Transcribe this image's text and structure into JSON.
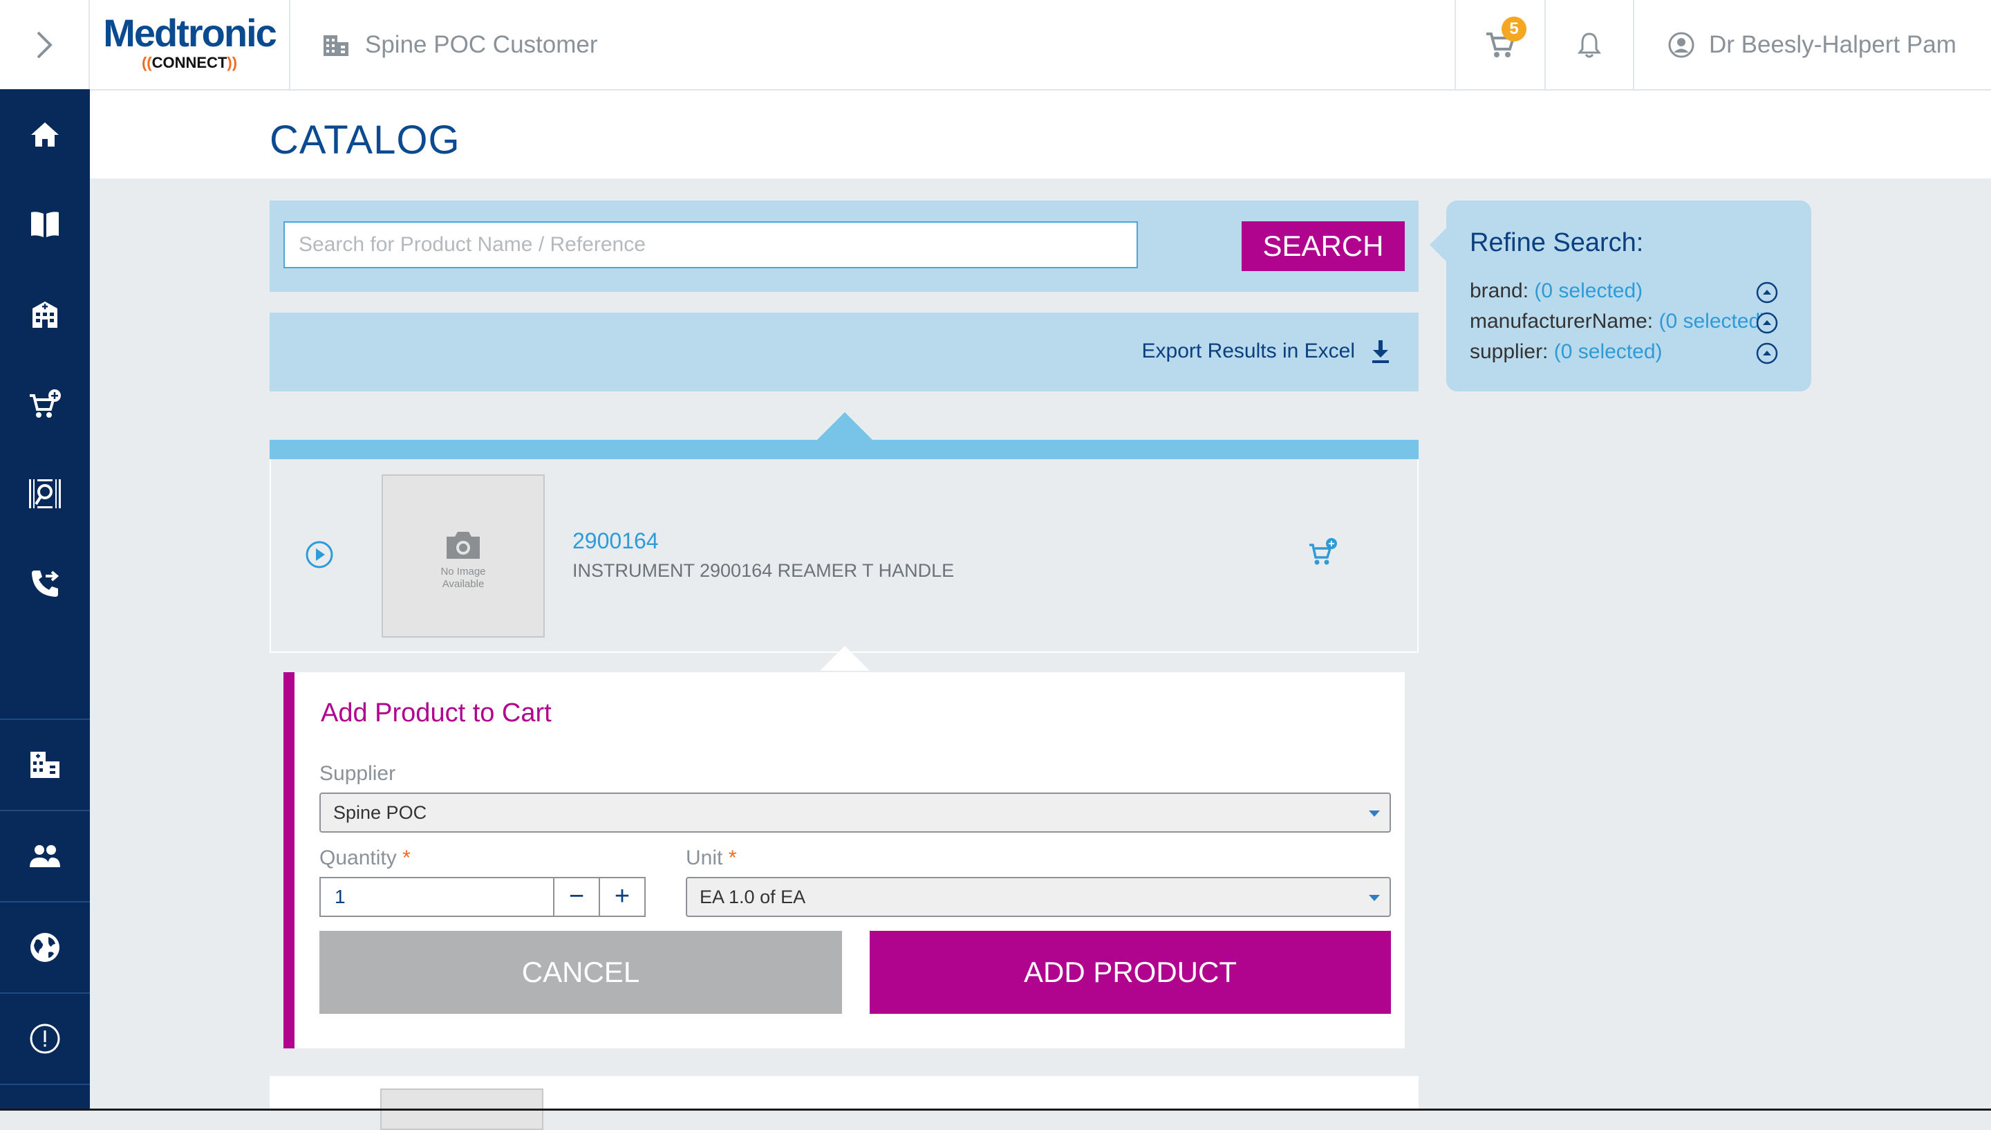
{
  "header": {
    "logo_brand": "Medtronic",
    "logo_sub": "CONNECT",
    "customer_name": "Spine POC Customer",
    "cart_count": "5",
    "user_name": "Dr Beesly-Halpert Pam"
  },
  "sidebar": {
    "items": [
      {
        "icon": "home-icon"
      },
      {
        "icon": "catalog-book-icon"
      },
      {
        "icon": "hospital-icon"
      },
      {
        "icon": "cart-add-icon"
      },
      {
        "icon": "barcode-scan-icon"
      },
      {
        "icon": "phone-forward-icon"
      },
      {
        "icon": "organization-icon"
      },
      {
        "icon": "users-icon"
      },
      {
        "icon": "globe-icon"
      },
      {
        "icon": "info-icon"
      }
    ]
  },
  "page": {
    "title": "CATALOG"
  },
  "search": {
    "placeholder": "Search for Product Name / Reference",
    "value": "",
    "button_label": "SEARCH",
    "export_label": "Export Results in Excel"
  },
  "refine": {
    "title": "Refine Search:",
    "filters": [
      {
        "name": "brand:",
        "selected": "(0 selected)"
      },
      {
        "name": "manufacturerName:",
        "selected": "(0 selected)"
      },
      {
        "name": "supplier:",
        "selected": "(0 selected)"
      }
    ]
  },
  "results": [
    {
      "code": "2900164",
      "description": "INSTRUMENT 2900164 REAMER T HANDLE",
      "image_text_line1": "No Image",
      "image_text_line2": "Available"
    }
  ],
  "add_form": {
    "title": "Add Product to Cart",
    "supplier_label": "Supplier",
    "supplier_value": "Spine POC",
    "quantity_label": "Quantity",
    "quantity_value": "1",
    "required_mark": "*",
    "unit_label": "Unit",
    "unit_value": "EA 1.0 of EA",
    "minus": "−",
    "plus": "+",
    "cancel_label": "CANCEL",
    "add_label": "ADD PRODUCT"
  },
  "colors": {
    "navy": "#072a5a",
    "brand_blue": "#0a4a90",
    "magenta": "#b0048e",
    "light_panel": "#b9d9ec",
    "link_blue": "#2f9bd6",
    "badge_orange": "#f5a623"
  }
}
